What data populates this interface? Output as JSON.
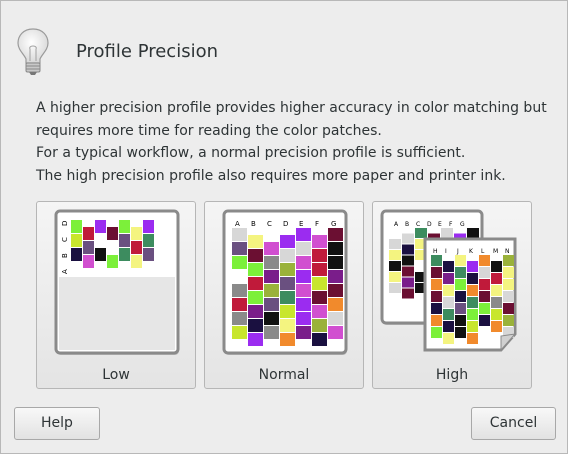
{
  "dialog": {
    "title": "Profile Precision",
    "description_lines": [
      "A higher precision profile provides higher accuracy in color matching but",
      "requires more time for reading the color patches.",
      "For a typical workflow, a normal precision profile is sufficient.",
      "The high precision profile also requires more paper and printer ink."
    ],
    "options": [
      {
        "label": "Low",
        "chart_letters": [
          "A",
          "B",
          "C",
          "D"
        ]
      },
      {
        "label": "Normal",
        "chart_letters": [
          "A",
          "B",
          "C",
          "D",
          "E",
          "F",
          "G"
        ]
      },
      {
        "label": "High",
        "chart_letters": [
          "A",
          "B",
          "C",
          "D",
          "E",
          "F",
          "G"
        ],
        "front_letters": [
          "H",
          "I",
          "J",
          "K",
          "L",
          "M",
          "N"
        ]
      }
    ],
    "buttons": {
      "help": "Help",
      "cancel": "Cancel"
    }
  },
  "patch_colors": [
    "#9b2cf0",
    "#f18a2c",
    "#d7d7d7",
    "#ffffff",
    "#111111",
    "#3d8c5f",
    "#c8e62d",
    "#9ab23a",
    "#6b0f32",
    "#8a8a8a",
    "#1a1040",
    "#7cf03a",
    "#7a1d8a",
    "#d14fd0",
    "#f4f480",
    "#6a5080",
    "#c01a3a"
  ]
}
